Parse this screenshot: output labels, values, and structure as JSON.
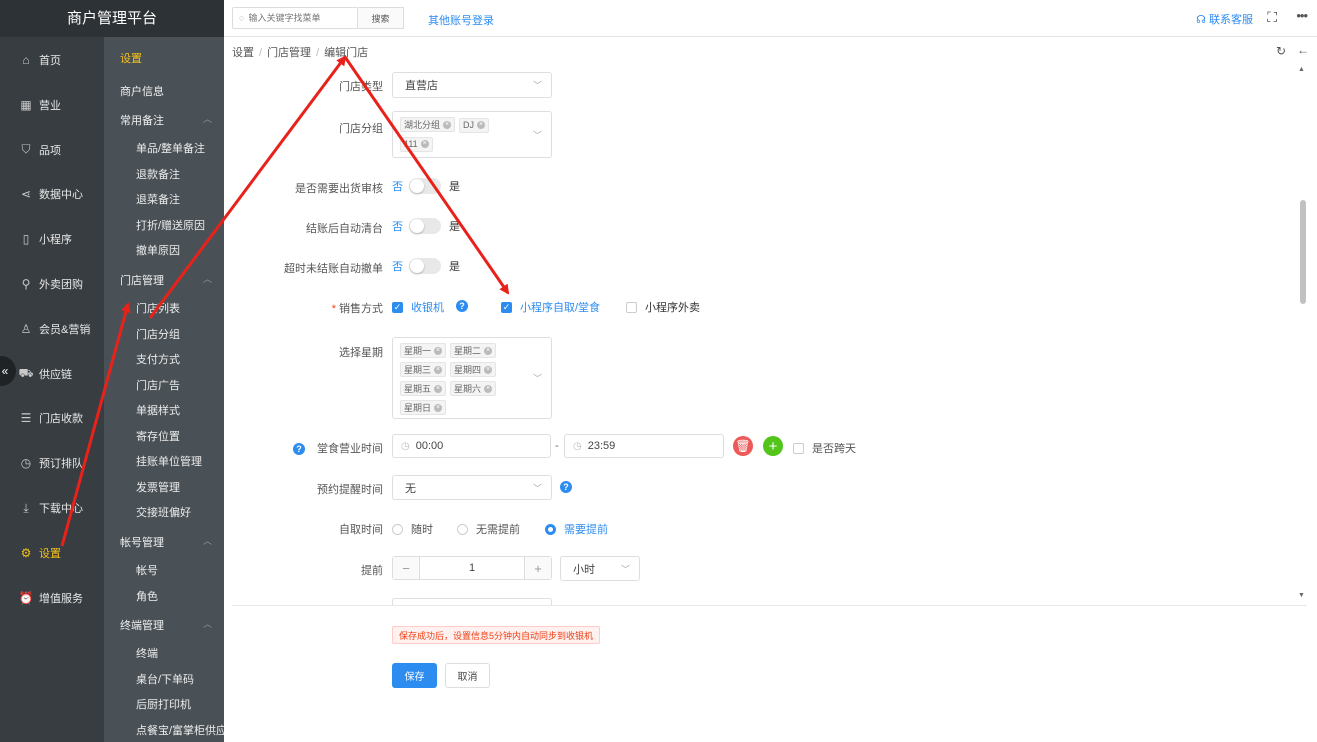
{
  "app": {
    "title": "商户管理平台"
  },
  "leftnav": {
    "items": [
      {
        "label": "首页",
        "icon": "home-icon"
      },
      {
        "label": "营业",
        "icon": "calendar-icon"
      },
      {
        "label": "品项",
        "icon": "bag-icon"
      },
      {
        "label": "数据中心",
        "icon": "share-icon"
      },
      {
        "label": "小程序",
        "icon": "phone-icon"
      },
      {
        "label": "外卖团购",
        "icon": "bike-icon"
      },
      {
        "label": "会员&营销",
        "icon": "user-icon"
      },
      {
        "label": "供应链",
        "icon": "truck-icon"
      },
      {
        "label": "门店收款",
        "icon": "database-icon"
      },
      {
        "label": "预订排队",
        "icon": "clock-icon"
      },
      {
        "label": "下载中心",
        "icon": "download-icon"
      },
      {
        "label": "设置",
        "icon": "gear-icon"
      },
      {
        "label": "增值服务",
        "icon": "alarm-icon"
      }
    ],
    "active_index": 11,
    "collapse_glyph": "«"
  },
  "subnav": {
    "title": "设置",
    "single": "商户信息",
    "groups": [
      {
        "label": "常用备注",
        "items": [
          "单品/整单备注",
          "退款备注",
          "退菜备注",
          "打折/赠送原因",
          "撤单原因"
        ]
      },
      {
        "label": "门店管理",
        "items": [
          "门店列表",
          "门店分组",
          "支付方式",
          "门店广告",
          "单据样式",
          "寄存位置",
          "挂账单位管理",
          "发票管理",
          "交接班偏好"
        ]
      },
      {
        "label": "帐号管理",
        "items": [
          "帐号",
          "角色"
        ]
      },
      {
        "label": "终端管理",
        "items": [
          "终端",
          "桌台/下单码",
          "后厨打印机",
          "点餐宝/富掌柜供应"
        ]
      }
    ]
  },
  "topbar": {
    "search_placeholder": "输入关键字找菜单",
    "search_button": "搜索",
    "other_login": "其他账号登录",
    "contact": "联系客服"
  },
  "breadcrumb": [
    "设置",
    "门店管理",
    "编辑门店"
  ],
  "form": {
    "store_type": {
      "label": "门店类型",
      "value": "直营店"
    },
    "store_group": {
      "label": "门店分组",
      "tags": [
        "湖北分组",
        "DJ",
        "111"
      ]
    },
    "audit": {
      "label": "是否需要出货审核",
      "off": "否",
      "on": "是"
    },
    "auto_clear": {
      "label": "结账后自动清台",
      "off": "否",
      "on": "是"
    },
    "timeout_cancel": {
      "label": "超时未结账自动撤单",
      "off": "否",
      "on": "是"
    },
    "sales_mode": {
      "label": "销售方式",
      "options": [
        {
          "label": "收银机",
          "checked": true
        },
        {
          "label": "小程序自取/堂食",
          "checked": true
        },
        {
          "label": "小程序外卖",
          "checked": false
        }
      ]
    },
    "weekdays": {
      "label": "选择星期",
      "tags": [
        "星期一",
        "星期二",
        "星期三",
        "星期四",
        "星期五",
        "星期六",
        "星期日"
      ]
    },
    "dine_hours": {
      "label": "堂食营业时间",
      "start": "00:00",
      "dash": "-",
      "end": "23:59",
      "cross_day": "是否跨天"
    },
    "reminder": {
      "label": "预约提醒时间",
      "value": "无"
    },
    "pickup": {
      "label": "自取时间",
      "options": [
        {
          "label": "随时",
          "checked": false
        },
        {
          "label": "无需提前",
          "checked": false
        },
        {
          "label": "需要提前",
          "checked": true
        }
      ]
    },
    "advance": {
      "label": "提前",
      "value": "1",
      "unit": "小时",
      "minus": "−",
      "plus": "+"
    }
  },
  "footer": {
    "notice": "保存成功后，设置信息5分钟内自动同步到收银机",
    "save": "保存",
    "cancel": "取消"
  },
  "colors": {
    "primary": "#2d8cf0",
    "annotation": "#e8221b",
    "nav_active": "#f5c21b"
  }
}
